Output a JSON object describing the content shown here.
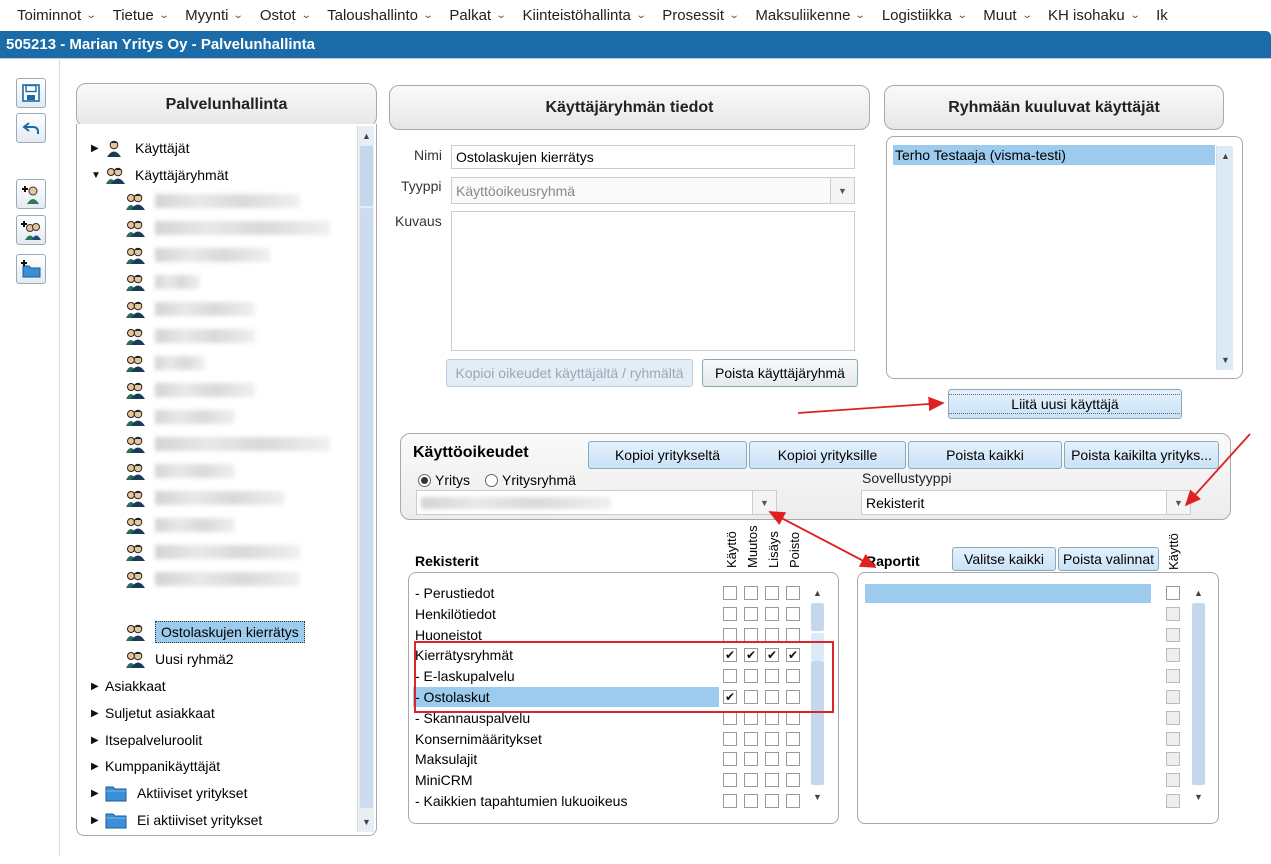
{
  "menu": [
    "Toiminnot",
    "Tietue",
    "Myynti",
    "Ostot",
    "Taloushallinto",
    "Palkat",
    "Kiinteistöhallinta",
    "Prosessit",
    "Maksuliikenne",
    "Logistiikka",
    "Muut",
    "KH isohaku",
    "Ik"
  ],
  "window_title": "505213 - Marian Yritys Oy - Palvelunhallinta",
  "left_panel": {
    "title": "Palvelunhallinta",
    "tree": {
      "users": "Käyttäjät",
      "groups": "Käyttäjäryhmät",
      "selected_group": "Ostolaskujen kierrätys",
      "new_group": "Uusi ryhmä2",
      "customers": "Asiakkaat",
      "closed_customers": "Suljetut asiakkaat",
      "self_service_roles": "Itsepalveluroolit",
      "partner_users": "Kumppanikäyttäjät",
      "active_companies": "Aktiiviset yritykset",
      "inactive_companies": "Ei aktiiviset yritykset"
    }
  },
  "group_details": {
    "title": "Käyttäjäryhmän tiedot",
    "name_label": "Nimi",
    "name_value": "Ostolaskujen kierrätys",
    "type_label": "Tyyppi",
    "type_value": "Käyttöoikeusryhmä",
    "desc_label": "Kuvaus",
    "copy_rights_button": "Kopioi oikeudet käyttäjältä / ryhmältä",
    "delete_group_button": "Poista käyttäjäryhmä"
  },
  "group_users": {
    "title": "Ryhmään kuuluvat käyttäjät",
    "users": [
      "Terho Testaaja (visma-testi)"
    ],
    "add_user_button": "Liitä uusi käyttäjä"
  },
  "permissions": {
    "title": "Käyttöoikeudet",
    "copy_from_company": "Kopioi yritykseltä",
    "copy_to_companies": "Kopioi yrityksille",
    "remove_all": "Poista kaikki",
    "remove_all_from_companies": "Poista kaikilta yrityks...",
    "radio_company": "Yritys",
    "radio_company_group": "Yritysryhmä",
    "app_type_label": "Sovellustyyppi",
    "app_type_value": "Rekisterit"
  },
  "registers": {
    "title": "Rekisterit",
    "columns": [
      "Käyttö",
      "Muutos",
      "Lisäys",
      "Poisto"
    ],
    "rows": [
      {
        "label": "- Perustiedot",
        "checks": [
          false,
          false,
          false,
          false
        ]
      },
      {
        "label": "Henkilötiedot",
        "checks": [
          false,
          false,
          false,
          false
        ]
      },
      {
        "label": "Huoneistot",
        "checks": [
          false,
          false,
          false,
          false
        ]
      },
      {
        "label": "Kierrätysryhmät",
        "checks": [
          true,
          true,
          true,
          true
        ]
      },
      {
        "label": "- E-laskupalvelu",
        "checks": [
          false,
          false,
          false,
          false
        ]
      },
      {
        "label": "- Ostolaskut",
        "checks": [
          true,
          false,
          false,
          false
        ]
      },
      {
        "label": "- Skannauspalvelu",
        "checks": [
          false,
          false,
          false,
          false
        ]
      },
      {
        "label": "Konsernimääritykset",
        "checks": [
          false,
          false,
          false,
          false
        ]
      },
      {
        "label": "Maksulajit",
        "checks": [
          false,
          false,
          false,
          false
        ]
      },
      {
        "label": "MiniCRM",
        "checks": [
          false,
          false,
          false,
          false
        ]
      },
      {
        "label": "- Kaikkien tapahtumien lukuoikeus",
        "checks": [
          false,
          false,
          false,
          false
        ]
      }
    ]
  },
  "reports": {
    "title": "Raportit",
    "select_all": "Valitse kaikki",
    "clear_selection": "Poista valinnat",
    "column": "Käyttö"
  },
  "colors": {
    "titlebar": "#1a6ba8",
    "selection": "#9ccbed",
    "annotation": "#e02020"
  },
  "check_glyph": "✔",
  "icons": {
    "tri_right": "▶",
    "tri_down": "▼",
    "chev": "⌄"
  }
}
